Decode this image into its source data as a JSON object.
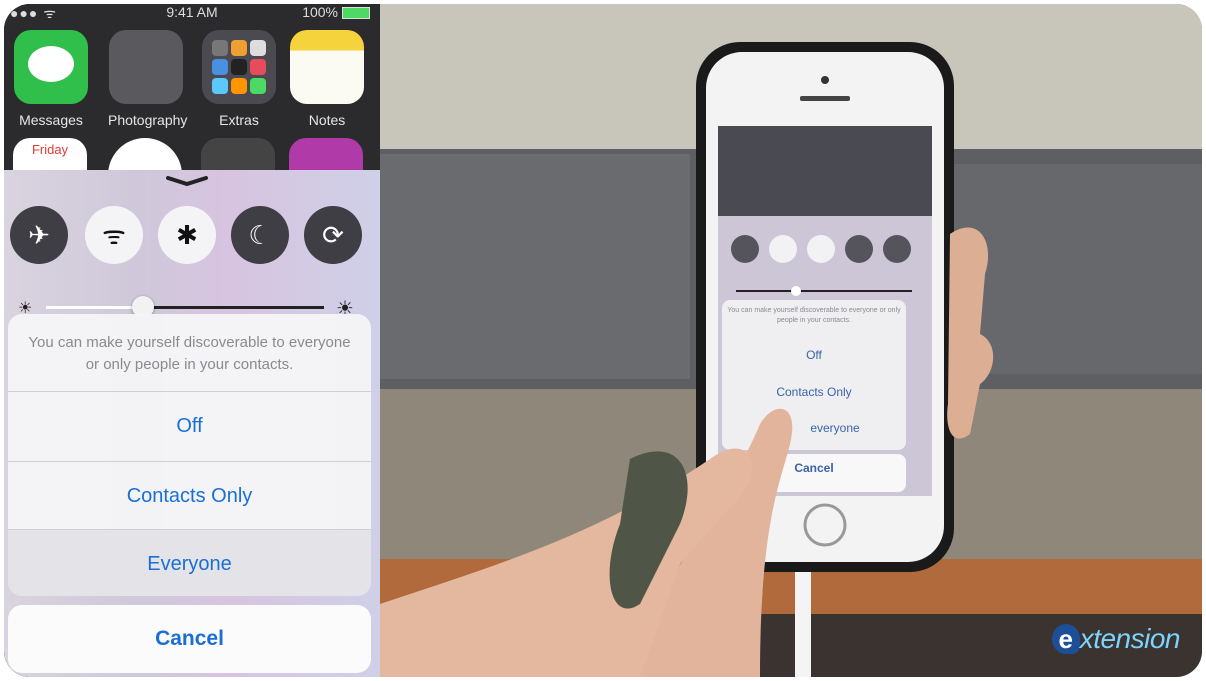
{
  "status_bar": {
    "signal": "●●●  ᯤ",
    "time": "9:41 AM",
    "battery": "100%"
  },
  "home_apps": [
    {
      "label": "Messages",
      "color": "#2fbf4a"
    },
    {
      "label": "Photography",
      "color": "#5a5a5e"
    },
    {
      "label": "Extras",
      "color": "#4a4a50"
    },
    {
      "label": "Notes",
      "color": "#f5d33d"
    }
  ],
  "home_apps_row2": {
    "calendar_day": "Friday"
  },
  "control_center": {
    "toggles": [
      {
        "name": "airplane-mode",
        "icon": "airplane-icon",
        "glyph": "✈",
        "on": false
      },
      {
        "name": "wifi",
        "icon": "wifi-icon",
        "glyph": "ᯤ",
        "on": true
      },
      {
        "name": "bluetooth",
        "icon": "bluetooth-icon",
        "glyph": "✱",
        "on": true
      },
      {
        "name": "do-not-disturb",
        "icon": "moon-icon",
        "glyph": "☾",
        "on": false
      },
      {
        "name": "rotation-lock",
        "icon": "rotation-lock-icon",
        "glyph": "⟳",
        "on": false
      }
    ],
    "brightness": 0.35
  },
  "airdrop_sheet": {
    "message": "You can make yourself discoverable to everyone or only people in your contacts.",
    "options": [
      "Off",
      "Contacts Only",
      "Everyone"
    ],
    "cancel": "Cancel"
  },
  "video_phone_sheet": {
    "message": "You can make yourself discoverable to everyone or only people in your contacts.",
    "options": [
      "Off",
      "Contacts Only",
      "everyone"
    ],
    "cancel": "Cancel"
  },
  "watermark": {
    "letter": "e",
    "text": "xtension"
  }
}
